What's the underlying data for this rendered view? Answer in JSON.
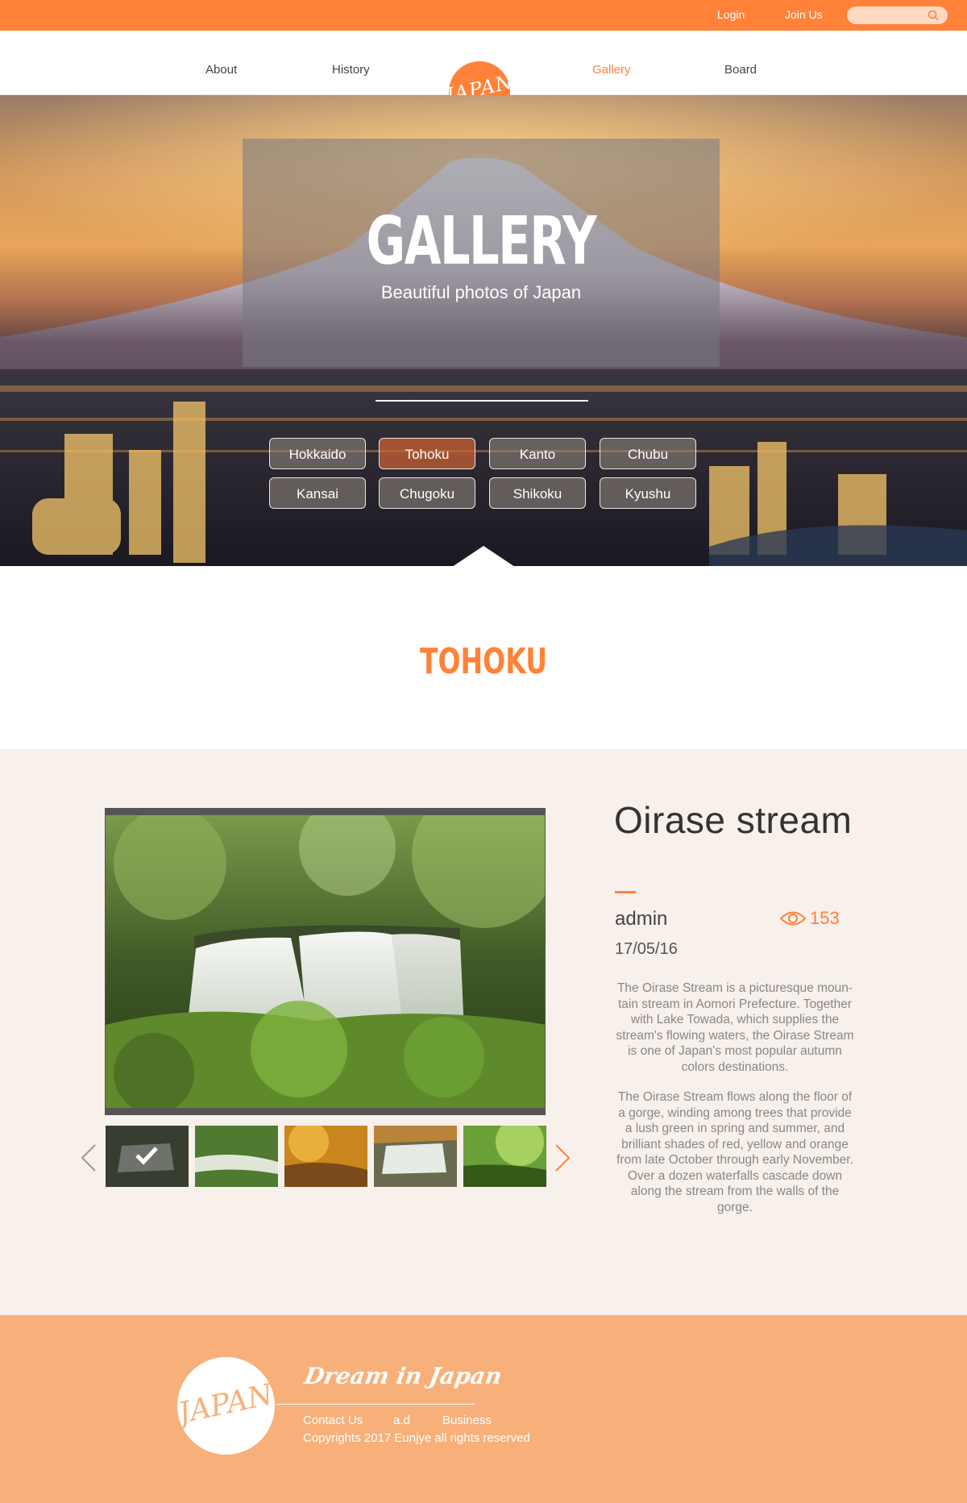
{
  "topbar": {
    "login": "Login",
    "join": "Join Us",
    "search_placeholder": ""
  },
  "nav": {
    "logo": "JAPAN",
    "items": [
      {
        "label": "About"
      },
      {
        "label": "History"
      },
      {
        "label": "Gallery"
      },
      {
        "label": "Board"
      }
    ],
    "active": "Gallery"
  },
  "hero": {
    "title": "GALLERY",
    "subtitle": "Beautiful photos of Japan",
    "regions": [
      "Hokkaido",
      "Tohoku",
      "Kanto",
      "Chubu",
      "Kansai",
      "Chugoku",
      "Shikoku",
      "Kyushu"
    ],
    "active_region": "Tohoku"
  },
  "region_heading": "TOHOKU",
  "post": {
    "title": "Oirase stream",
    "author": "admin",
    "views": "153",
    "date": "17/05/16",
    "paragraph1_lines": [
      "The Oirase Stream is a picturesque moun-",
      "tain stream in Aomori Prefecture. Together",
      "with Lake Towada, which supplies the",
      "stream's flowing waters, the Oirase Stream",
      "is one of Japan's most popular autumn",
      "colors destinations."
    ],
    "paragraph2_lines": [
      "The Oirase Stream flows along the floor of",
      "a gorge, winding among trees that provide",
      "a lush green in spring and summer, and",
      "brilliant shades of red, yellow and orange",
      "from late October through early November.",
      "Over a dozen waterfalls cascade down",
      "along the stream from the walls of the",
      "gorge."
    ],
    "selected_thumbnail": 1,
    "thumbnail_count": 5
  },
  "footer": {
    "logo": "JAPAN",
    "tagline": "Dream in Japan",
    "links": [
      "Contact Us",
      "a.d",
      "Business"
    ],
    "copyright": "Copyrights 2017 Eunjye all rights reserved"
  },
  "colors": {
    "accent": "#ff8238",
    "footer": "#f8b07a",
    "content_bg": "#f7f0eb"
  }
}
